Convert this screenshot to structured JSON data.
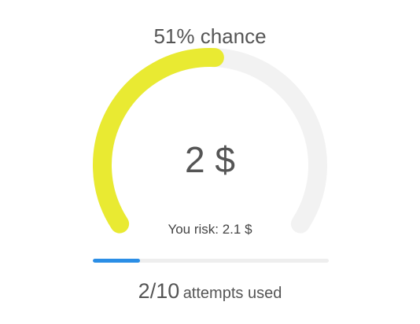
{
  "chance": {
    "label": "51% chance",
    "value_percent": 51
  },
  "amount": {
    "label": "2 $"
  },
  "risk": {
    "label": "You risk: 2.1 $"
  },
  "attempts": {
    "count_label": "2/10",
    "suffix_label": "attempts used",
    "used": 2,
    "total": 10
  },
  "colors": {
    "gauge_fill": "#e9ea32",
    "gauge_track": "#f2f2f2",
    "progress_fill": "#2b8ee6",
    "progress_track": "#eeeeee",
    "text": "#555555"
  }
}
